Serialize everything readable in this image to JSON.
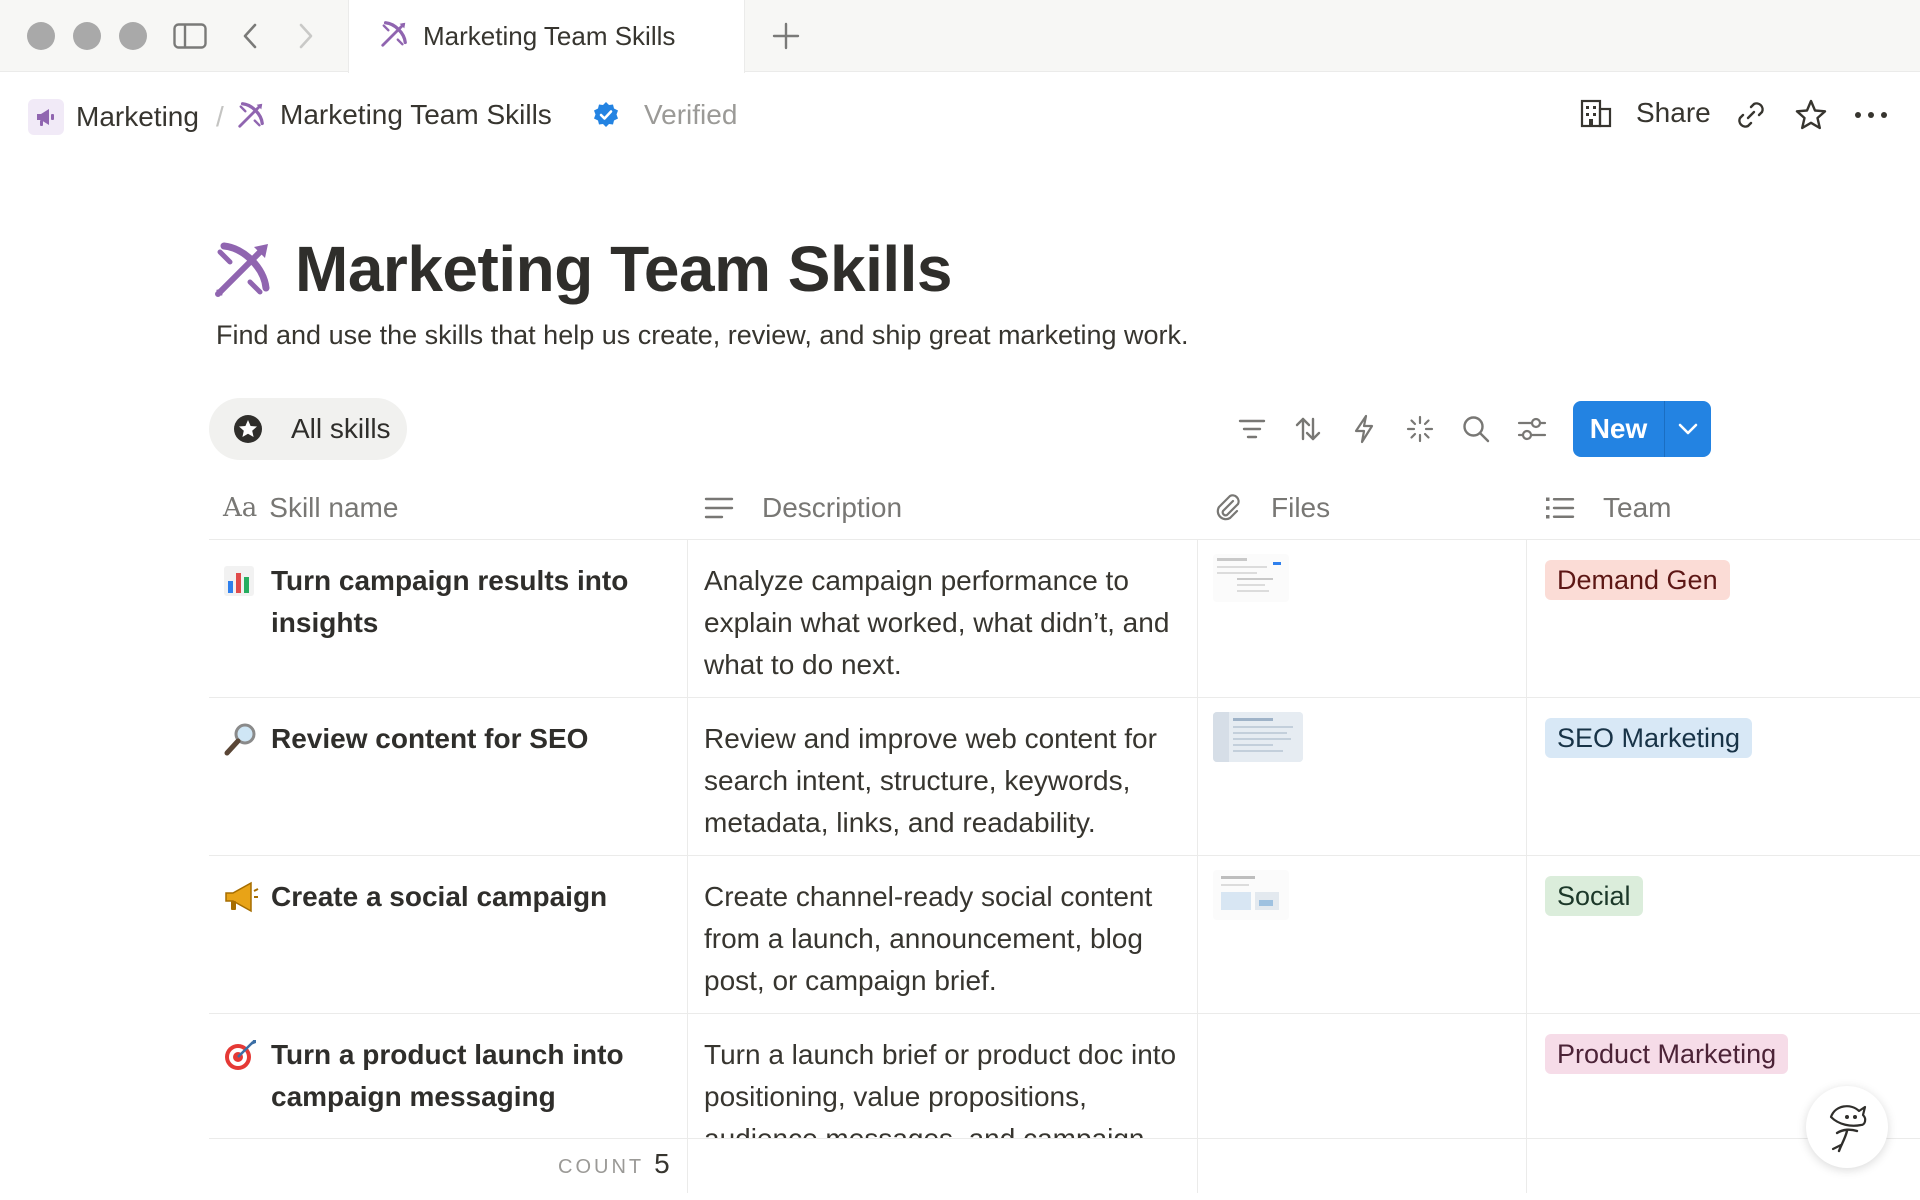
{
  "tab": {
    "title": "Marketing Team Skills"
  },
  "breadcrumb": {
    "parent": "Marketing",
    "current": "Marketing Team Skills",
    "verified": "Verified"
  },
  "topbar": {
    "share_label": "Share"
  },
  "page": {
    "title": "Marketing Team Skills",
    "description": "Find and use the skills that help us create, review, and ship great marketing work."
  },
  "views": {
    "active_label": "All skills"
  },
  "toolbar": {
    "new_label": "New"
  },
  "table": {
    "columns": [
      "Skill name",
      "Description",
      "Files",
      "Team"
    ],
    "rows": [
      {
        "emoji": "📊",
        "name": "Turn campaign results into insights",
        "description": "Analyze campaign performance to explain what worked, what didn’t, and what to do next.",
        "has_file": true,
        "team": "Demand Gen",
        "team_bg": "#fbdcd6",
        "team_fg": "#5d1715"
      },
      {
        "emoji": "🔎",
        "name": "Review content for SEO",
        "description": "Review and improve web content for search intent, structure, keywords, metadata, links, and readability.",
        "has_file": true,
        "team": "SEO Marketing",
        "team_bg": "#d8e8f6",
        "team_fg": "#183347"
      },
      {
        "emoji": "📣",
        "name": "Create a social campaign",
        "description": "Create channel-ready social content from a launch, announcement, blog post, or campaign brief.",
        "has_file": true,
        "team": "Social",
        "team_bg": "#dbeddb",
        "team_fg": "#1c3829"
      },
      {
        "emoji": "🎯",
        "name": "Turn a product launch into campaign messaging",
        "description": "Turn a launch brief or product doc into positioning, value propositions, audience messages, and campaign",
        "has_file": false,
        "team": "Product Marketing",
        "team_bg": "#f6dce8",
        "team_fg": "#4c2337"
      }
    ]
  },
  "footer": {
    "count_label": "COUNT",
    "count_value": "5"
  },
  "colors": {
    "accent": "#2383e2",
    "brand_purple": "#9065b0"
  },
  "icons": [
    "sidebar-toggle-icon",
    "back-icon",
    "forward-icon",
    "plus-icon",
    "megaphone-icon",
    "bow-arrow-icon",
    "verified-badge-icon",
    "building-icon",
    "link-icon",
    "star-icon",
    "more-icon",
    "filter-icon",
    "sort-icon",
    "lightning-icon",
    "sparkle-icon",
    "search-icon",
    "settings-sliders-icon",
    "chevron-down-icon"
  ]
}
